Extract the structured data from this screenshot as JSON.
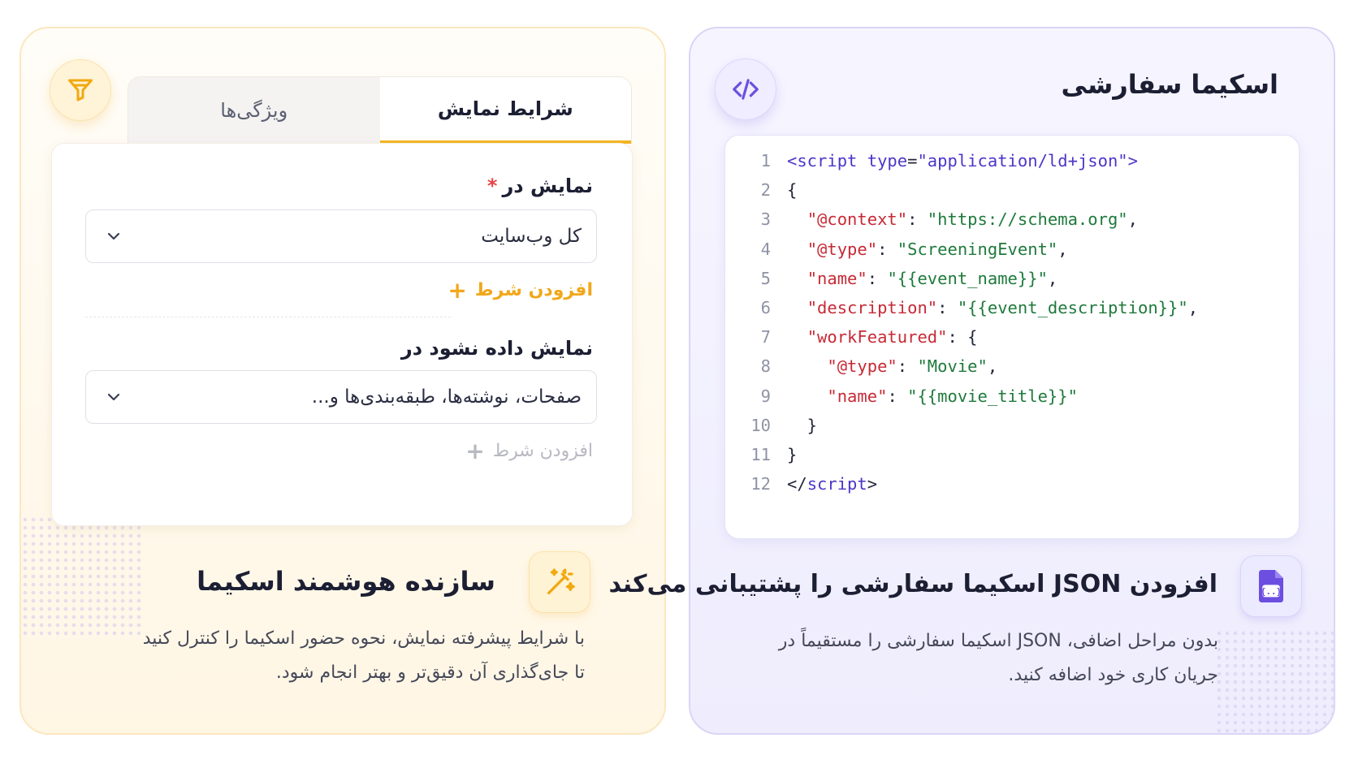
{
  "left_card": {
    "tabs": [
      {
        "label": "شرایط نمایش",
        "active": true
      },
      {
        "label": "ویژگی‌ها",
        "active": false
      }
    ],
    "display_in": {
      "label": "نمایش در",
      "required_mark": "*",
      "value": "کل وب‌سایت"
    },
    "add_condition_1": {
      "plus": "+",
      "label": "افزودن شرط"
    },
    "exclude": {
      "label": "نمایش داده نشود در",
      "value": "صفحات، نوشته‌ها، طبقه‌بندی‌ها و..."
    },
    "add_condition_2": {
      "plus": "+",
      "label": "افزودن شرط"
    },
    "feature": {
      "title": "سازنده هوشمند اسکیما",
      "desc_line1": "با شرایط پیشرفته نمایش، نحوه حضور اسکیما را کنترل کنید",
      "desc_line2": "تا جای‌گذاری آن دقیق‌تر و بهتر انجام شود."
    }
  },
  "right_card": {
    "title": "اسکیما سفارشی",
    "code_lines": [
      {
        "n": "1",
        "tokens": [
          [
            "tag",
            "<script "
          ],
          [
            "attr",
            "type"
          ],
          [
            "p",
            "="
          ],
          [
            "tag",
            "\"application/ld+json\">"
          ]
        ]
      },
      {
        "n": "2",
        "tokens": [
          [
            "p",
            "{"
          ]
        ]
      },
      {
        "n": "3",
        "tokens": [
          [
            "p",
            "  "
          ],
          [
            "key",
            "\"@context\""
          ],
          [
            "p",
            ": "
          ],
          [
            "str",
            "\"https://schema.org\""
          ],
          [
            "p",
            ","
          ]
        ]
      },
      {
        "n": "4",
        "tokens": [
          [
            "p",
            "  "
          ],
          [
            "key",
            "\"@type\""
          ],
          [
            "p",
            ": "
          ],
          [
            "str",
            "\"ScreeningEvent\""
          ],
          [
            "p",
            ","
          ]
        ]
      },
      {
        "n": "5",
        "tokens": [
          [
            "p",
            "  "
          ],
          [
            "key",
            "\"name\""
          ],
          [
            "p",
            ": "
          ],
          [
            "str",
            "\"{{event_name}}\""
          ],
          [
            "p",
            ","
          ]
        ]
      },
      {
        "n": "6",
        "tokens": [
          [
            "p",
            "  "
          ],
          [
            "key",
            "\"description\""
          ],
          [
            "p",
            ": "
          ],
          [
            "str",
            "\"{{event_description}}\""
          ],
          [
            "p",
            ","
          ]
        ]
      },
      {
        "n": "7",
        "tokens": [
          [
            "p",
            "  "
          ],
          [
            "key",
            "\"workFeatured\""
          ],
          [
            "p",
            ": {"
          ]
        ]
      },
      {
        "n": "8",
        "tokens": [
          [
            "p",
            "    "
          ],
          [
            "key",
            "\"@type\""
          ],
          [
            "p",
            ": "
          ],
          [
            "str",
            "\"Movie\""
          ],
          [
            "p",
            ","
          ]
        ]
      },
      {
        "n": "9",
        "tokens": [
          [
            "p",
            "    "
          ],
          [
            "key",
            "\"name\""
          ],
          [
            "p",
            ": "
          ],
          [
            "str",
            "\"{{movie_title}}\""
          ]
        ]
      },
      {
        "n": "10",
        "tokens": [
          [
            "p",
            "  }"
          ]
        ]
      },
      {
        "n": "11",
        "tokens": [
          [
            "p",
            "}"
          ]
        ]
      },
      {
        "n": "12",
        "tokens": [
          [
            "p",
            "</"
          ],
          [
            "tag",
            "script"
          ],
          [
            "p",
            ">"
          ]
        ]
      }
    ],
    "feature": {
      "title": "افزودن JSON اسکیما سفارشی را پشتیبانی می‌کند",
      "desc_line1": "بدون مراحل اضافی، JSON اسکیما سفارشی را مستقیماً در",
      "desc_line2": "جریان کاری خود اضافه کنید."
    }
  },
  "colors": {
    "accent_yellow": "#f4b620",
    "accent_purple": "#6c4fe0",
    "code_key": "#c62a36",
    "code_string": "#1f7a3c",
    "code_tag": "#4b36c9"
  },
  "icons": [
    "filter-icon",
    "code-brackets-icon",
    "chevron-down-icon",
    "magic-wand-icon",
    "json-file-icon"
  ]
}
